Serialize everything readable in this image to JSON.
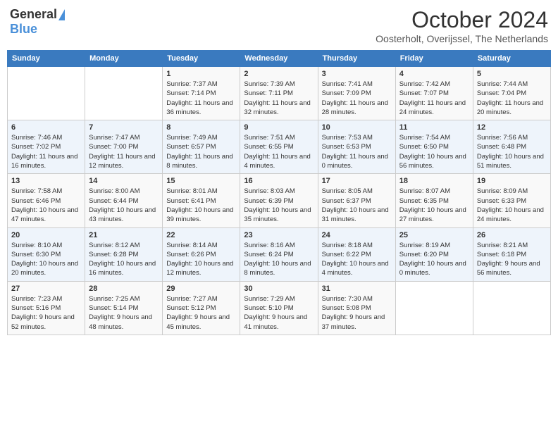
{
  "header": {
    "logo_general": "General",
    "logo_blue": "Blue",
    "title": "October 2024",
    "location": "Oosterholt, Overijssel, The Netherlands"
  },
  "weekdays": [
    "Sunday",
    "Monday",
    "Tuesday",
    "Wednesday",
    "Thursday",
    "Friday",
    "Saturday"
  ],
  "weeks": [
    [
      {
        "day": "",
        "detail": ""
      },
      {
        "day": "",
        "detail": ""
      },
      {
        "day": "1",
        "detail": "Sunrise: 7:37 AM\nSunset: 7:14 PM\nDaylight: 11 hours and 36 minutes."
      },
      {
        "day": "2",
        "detail": "Sunrise: 7:39 AM\nSunset: 7:11 PM\nDaylight: 11 hours and 32 minutes."
      },
      {
        "day": "3",
        "detail": "Sunrise: 7:41 AM\nSunset: 7:09 PM\nDaylight: 11 hours and 28 minutes."
      },
      {
        "day": "4",
        "detail": "Sunrise: 7:42 AM\nSunset: 7:07 PM\nDaylight: 11 hours and 24 minutes."
      },
      {
        "day": "5",
        "detail": "Sunrise: 7:44 AM\nSunset: 7:04 PM\nDaylight: 11 hours and 20 minutes."
      }
    ],
    [
      {
        "day": "6",
        "detail": "Sunrise: 7:46 AM\nSunset: 7:02 PM\nDaylight: 11 hours and 16 minutes."
      },
      {
        "day": "7",
        "detail": "Sunrise: 7:47 AM\nSunset: 7:00 PM\nDaylight: 11 hours and 12 minutes."
      },
      {
        "day": "8",
        "detail": "Sunrise: 7:49 AM\nSunset: 6:57 PM\nDaylight: 11 hours and 8 minutes."
      },
      {
        "day": "9",
        "detail": "Sunrise: 7:51 AM\nSunset: 6:55 PM\nDaylight: 11 hours and 4 minutes."
      },
      {
        "day": "10",
        "detail": "Sunrise: 7:53 AM\nSunset: 6:53 PM\nDaylight: 11 hours and 0 minutes."
      },
      {
        "day": "11",
        "detail": "Sunrise: 7:54 AM\nSunset: 6:50 PM\nDaylight: 10 hours and 56 minutes."
      },
      {
        "day": "12",
        "detail": "Sunrise: 7:56 AM\nSunset: 6:48 PM\nDaylight: 10 hours and 51 minutes."
      }
    ],
    [
      {
        "day": "13",
        "detail": "Sunrise: 7:58 AM\nSunset: 6:46 PM\nDaylight: 10 hours and 47 minutes."
      },
      {
        "day": "14",
        "detail": "Sunrise: 8:00 AM\nSunset: 6:44 PM\nDaylight: 10 hours and 43 minutes."
      },
      {
        "day": "15",
        "detail": "Sunrise: 8:01 AM\nSunset: 6:41 PM\nDaylight: 10 hours and 39 minutes."
      },
      {
        "day": "16",
        "detail": "Sunrise: 8:03 AM\nSunset: 6:39 PM\nDaylight: 10 hours and 35 minutes."
      },
      {
        "day": "17",
        "detail": "Sunrise: 8:05 AM\nSunset: 6:37 PM\nDaylight: 10 hours and 31 minutes."
      },
      {
        "day": "18",
        "detail": "Sunrise: 8:07 AM\nSunset: 6:35 PM\nDaylight: 10 hours and 27 minutes."
      },
      {
        "day": "19",
        "detail": "Sunrise: 8:09 AM\nSunset: 6:33 PM\nDaylight: 10 hours and 24 minutes."
      }
    ],
    [
      {
        "day": "20",
        "detail": "Sunrise: 8:10 AM\nSunset: 6:30 PM\nDaylight: 10 hours and 20 minutes."
      },
      {
        "day": "21",
        "detail": "Sunrise: 8:12 AM\nSunset: 6:28 PM\nDaylight: 10 hours and 16 minutes."
      },
      {
        "day": "22",
        "detail": "Sunrise: 8:14 AM\nSunset: 6:26 PM\nDaylight: 10 hours and 12 minutes."
      },
      {
        "day": "23",
        "detail": "Sunrise: 8:16 AM\nSunset: 6:24 PM\nDaylight: 10 hours and 8 minutes."
      },
      {
        "day": "24",
        "detail": "Sunrise: 8:18 AM\nSunset: 6:22 PM\nDaylight: 10 hours and 4 minutes."
      },
      {
        "day": "25",
        "detail": "Sunrise: 8:19 AM\nSunset: 6:20 PM\nDaylight: 10 hours and 0 minutes."
      },
      {
        "day": "26",
        "detail": "Sunrise: 8:21 AM\nSunset: 6:18 PM\nDaylight: 9 hours and 56 minutes."
      }
    ],
    [
      {
        "day": "27",
        "detail": "Sunrise: 7:23 AM\nSunset: 5:16 PM\nDaylight: 9 hours and 52 minutes."
      },
      {
        "day": "28",
        "detail": "Sunrise: 7:25 AM\nSunset: 5:14 PM\nDaylight: 9 hours and 48 minutes."
      },
      {
        "day": "29",
        "detail": "Sunrise: 7:27 AM\nSunset: 5:12 PM\nDaylight: 9 hours and 45 minutes."
      },
      {
        "day": "30",
        "detail": "Sunrise: 7:29 AM\nSunset: 5:10 PM\nDaylight: 9 hours and 41 minutes."
      },
      {
        "day": "31",
        "detail": "Sunrise: 7:30 AM\nSunset: 5:08 PM\nDaylight: 9 hours and 37 minutes."
      },
      {
        "day": "",
        "detail": ""
      },
      {
        "day": "",
        "detail": ""
      }
    ]
  ]
}
